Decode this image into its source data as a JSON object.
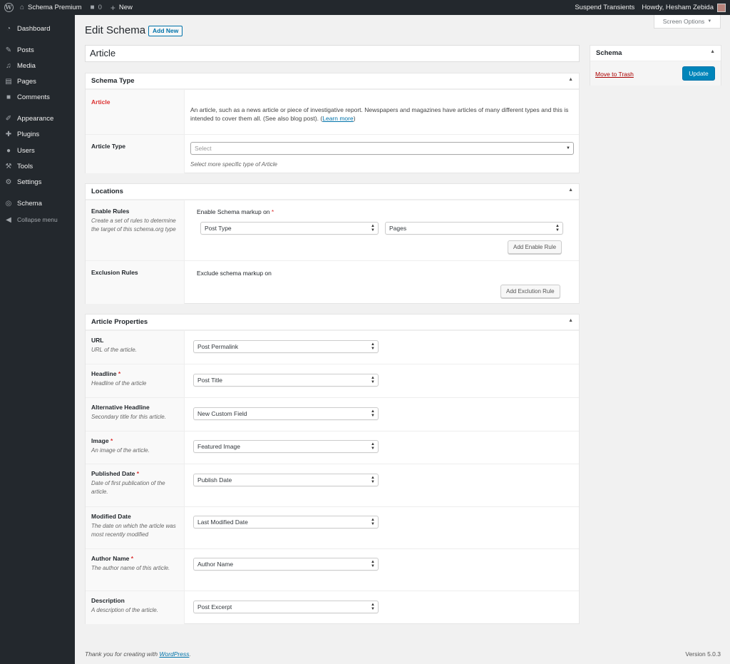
{
  "adminbar": {
    "site_name": "Schema Premium",
    "comments_count": "0",
    "new_label": "New",
    "suspend_label": "Suspend Transients",
    "howdy_label": "Howdy, Hesham Zebida"
  },
  "sidebar": {
    "items": [
      {
        "label": "Dashboard",
        "icon": "dashboard-icon"
      },
      {
        "label": "Posts",
        "icon": "pin-icon"
      },
      {
        "label": "Media",
        "icon": "media-icon"
      },
      {
        "label": "Pages",
        "icon": "pages-icon"
      },
      {
        "label": "Comments",
        "icon": "comment-icon"
      },
      {
        "label": "Appearance",
        "icon": "brush-icon"
      },
      {
        "label": "Plugins",
        "icon": "plug-icon"
      },
      {
        "label": "Users",
        "icon": "user-icon"
      },
      {
        "label": "Tools",
        "icon": "wrench-icon"
      },
      {
        "label": "Settings",
        "icon": "sliders-icon"
      },
      {
        "label": "Schema",
        "icon": "schema-icon"
      },
      {
        "label": "Collapse menu",
        "icon": "collapse-icon"
      }
    ]
  },
  "header": {
    "title": "Edit Schema",
    "add_new": "Add New",
    "screen_options": "Screen Options"
  },
  "post_title": "Article",
  "schema_type_box": {
    "title": "Schema Type",
    "type_label": "Article",
    "type_description": "An article, such as a news article or piece of investigative report. Newspapers and magazines have articles of many different types and this is intended to cover them all. (See also blog post).",
    "learn_more": "Learn more",
    "article_type_label": "Article Type",
    "article_type_placeholder": "Select",
    "article_type_hint": "Select more specific type of Article"
  },
  "locations_box": {
    "title": "Locations",
    "enable_label": "Enable Rules",
    "enable_desc": "Create a set of rules to determine the target of this schema.org type",
    "enable_heading": "Enable Schema markup on",
    "rule_param": "Post Type",
    "rule_value": "Pages",
    "add_enable": "Add Enable Rule",
    "exclusion_label": "Exclusion Rules",
    "exclusion_heading": "Exclude schema markup on",
    "add_exclusion": "Add Exclution Rule"
  },
  "properties_box": {
    "title": "Article Properties",
    "rows": [
      {
        "label": "URL",
        "required": false,
        "desc": "URL of the article.",
        "value": "Post Permalink"
      },
      {
        "label": "Headline",
        "required": true,
        "desc": "Headline of the article",
        "value": "Post Title"
      },
      {
        "label": "Alternative Headline",
        "required": false,
        "desc": "Secondary title for this article.",
        "value": "New Custom Field"
      },
      {
        "label": "Image",
        "required": true,
        "desc": "An image of the article.",
        "value": "Featured Image"
      },
      {
        "label": "Published Date",
        "required": true,
        "desc": "Date of first publication of the article.",
        "value": "Publish Date"
      },
      {
        "label": "Modified Date",
        "required": false,
        "desc": "The date on which the article was most recently modified",
        "value": "Last Modified Date"
      },
      {
        "label": "Author Name",
        "required": true,
        "desc": "The author name of this article.",
        "value": "Author Name"
      },
      {
        "label": "Description",
        "required": false,
        "desc": "A description of the article.",
        "value": "Post Excerpt"
      }
    ]
  },
  "publish_box": {
    "title": "Schema",
    "trash": "Move to Trash",
    "update": "Update"
  },
  "footer": {
    "thanks_prefix": "Thank you for creating with",
    "wordpress": "WordPress",
    "thanks_suffix": ".",
    "version": "Version 5.0.3"
  },
  "colors": {
    "adminbar_bg": "#23282d",
    "accent": "#0073aa",
    "required": "#dc3232",
    "page_bg": "#f1f1f1"
  }
}
